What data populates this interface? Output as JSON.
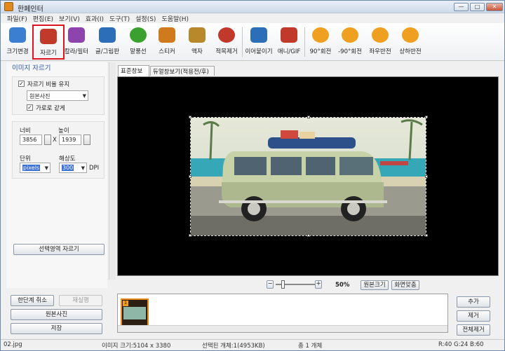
{
  "window": {
    "title": "한페인터",
    "minimize": "—",
    "maximize": "□",
    "close": "✕"
  },
  "menu": [
    "파일(F)",
    "편집(E)",
    "보기(V)",
    "효과(I)",
    "도구(T)",
    "설정(S)",
    "도움말(H)"
  ],
  "toolbar": {
    "active": "자르기",
    "items": [
      {
        "label": "크기변경",
        "icon": "resize-icon",
        "color": "#3a7fd0"
      },
      {
        "label": "자르기",
        "icon": "crop-icon",
        "color": "#c0392b"
      },
      {
        "label": "칼라/필터",
        "icon": "color-filter-icon",
        "color": "#8e44ad"
      },
      {
        "label": "글/그림판",
        "icon": "text-draw-icon",
        "color": "#2c6fb8"
      },
      {
        "label": "말풍선",
        "icon": "speech-bubble-icon",
        "color": "#3aa12e"
      },
      {
        "label": "스티커",
        "icon": "sticker-icon",
        "color": "#d07a1e"
      },
      {
        "label": "액자",
        "icon": "frame-icon",
        "color": "#b8892a"
      },
      {
        "label": "적목제거",
        "icon": "red-eye-icon",
        "color": "#c0392b"
      },
      {
        "label": "이어붙이기",
        "icon": "join-icon",
        "color": "#2c6fb8"
      },
      {
        "label": "애니/GIF",
        "icon": "gif-icon",
        "color": "#c0392b"
      },
      {
        "label": "90°회전",
        "icon": "rotate-cw-icon",
        "color": "#f0a020"
      },
      {
        "label": "-90°회전",
        "icon": "rotate-ccw-icon",
        "color": "#f0a020"
      },
      {
        "label": "좌우반전",
        "icon": "flip-horizontal-icon",
        "color": "#f0a020"
      },
      {
        "label": "상하반전",
        "icon": "flip-vertical-icon",
        "color": "#f0a020"
      }
    ]
  },
  "crop_panel": {
    "title": "이미지 자르기",
    "keep_ratio_label": "자르기 비율 유지",
    "keep_ratio_checked": true,
    "ratio_value": "원본사진",
    "landscape_label": "가로로 같게",
    "landscape_checked": true,
    "width_label": "너비",
    "height_label": "높이",
    "width_value": "3856",
    "height_value": "1939",
    "times": "X",
    "unit_label": "단위",
    "unit_value": "pixels",
    "resolution_label": "해상도",
    "resolution_value": "300",
    "resolution_unit": "DPI",
    "crop_selection_button": "선택영역 자르기"
  },
  "left_buttons": {
    "undo": "한단계 취소",
    "redo": "재실행",
    "original": "원본사진",
    "save": "저장"
  },
  "tabs": [
    "표준창보기",
    "듀얼창보기(적용전/후)"
  ],
  "zoom": {
    "minus": "−",
    "plus": "+",
    "level": "50%",
    "fit_original": "원본크기",
    "fit_window": "화면맞춤",
    "slider": 0.15
  },
  "right_buttons": {
    "add": "추가",
    "remove": "제거",
    "remove_all": "전체제거"
  },
  "status": {
    "filename": "02.jpg",
    "image_size": "이미지 크기:5104 x 3380",
    "selected": "선택된 개체:1(4953KB)",
    "total": "총 1 개체",
    "color": "R:40 G:24 B:60"
  },
  "thumbnail": {
    "badge": "1"
  }
}
